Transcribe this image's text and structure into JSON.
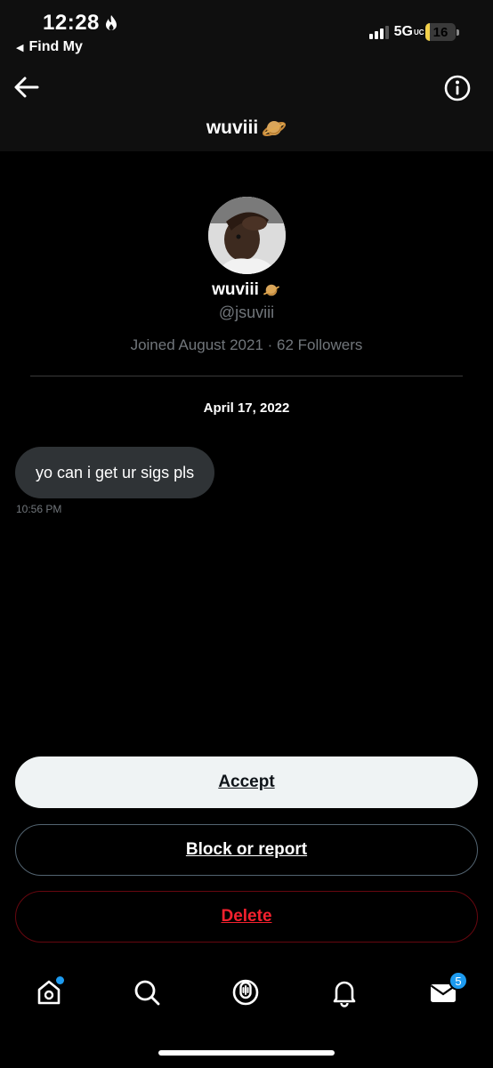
{
  "status_bar": {
    "time": "12:28",
    "back_app": "Find My",
    "network": "5G",
    "network_suffix": "UC",
    "battery": "16",
    "battery_level": 0.16
  },
  "header": {
    "title": "wuviii"
  },
  "profile": {
    "name": "wuviii",
    "handle": "@jsuviii",
    "joined": "Joined August 2021 · 62 Followers"
  },
  "conversation": {
    "date": "April 17, 2022",
    "messages": [
      {
        "text": "yo can i get ur sigs pls",
        "time": "10:56 PM"
      }
    ]
  },
  "actions": {
    "accept": "Accept",
    "block": "Block or report",
    "delete": "Delete"
  },
  "tab_bar": {
    "tabs": [
      "home-icon",
      "search-icon",
      "spaces-icon",
      "notifications-icon",
      "messages-icon"
    ],
    "messages_badge": "5"
  },
  "colors": {
    "background": "#000000",
    "header_bg": "#0f0f0f",
    "accent": "#1d9bf0",
    "delete_red": "#f4212e",
    "muted_text": "#71767b",
    "bubble_bg": "#2f3336"
  }
}
